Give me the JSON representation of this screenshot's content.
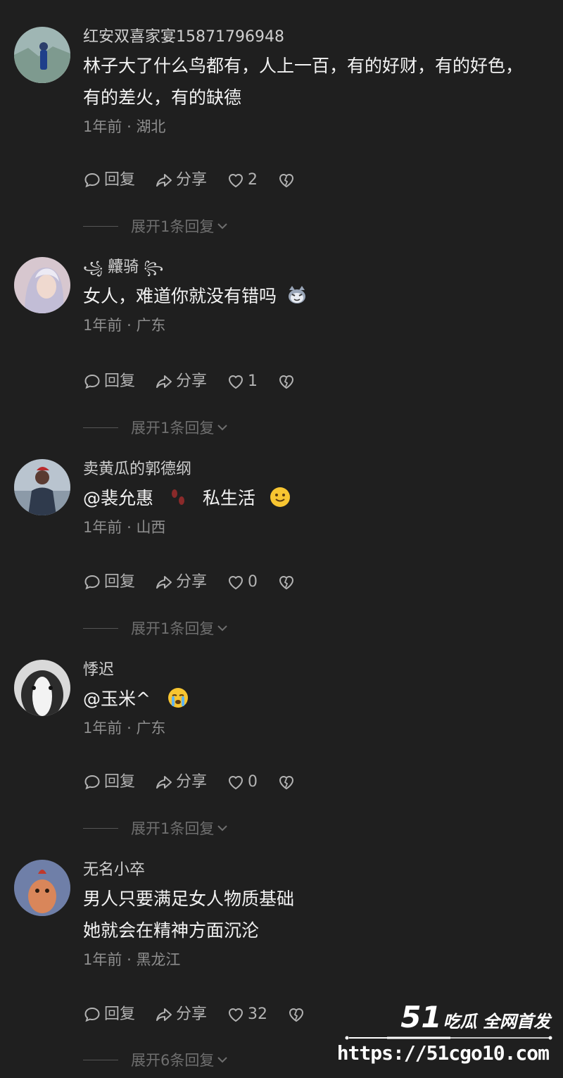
{
  "comments": [
    {
      "username": "红安双喜家宴15871796948",
      "text_lines": [
        "林子大了什么鸟都有，人上一百，有的好财，有的好色，",
        "有的差火，有的缺德"
      ],
      "time": "1年前",
      "location": "湖北",
      "reply_label": "回复",
      "share_label": "分享",
      "likes": "2",
      "expand_label": "展开1条回复"
    },
    {
      "username": "齉骑",
      "username_prefix": "꧁",
      "username_suffix": "꧂",
      "text": "女人，难道你就没有错吗",
      "emoji": "cat-face-emoji",
      "time": "1年前",
      "location": "广东",
      "reply_label": "回复",
      "share_label": "分享",
      "likes": "1",
      "expand_label": "展开1条回复"
    },
    {
      "username": "卖黄瓜的郭德纲",
      "mention": "@裴允惠",
      "text_after": "私生活",
      "emoji1": "footprints-emoji",
      "emoji2": "smiling-face-emoji",
      "time": "1年前",
      "location": "山西",
      "reply_label": "回复",
      "share_label": "分享",
      "likes": "0",
      "expand_label": "展开1条回复"
    },
    {
      "username": "悸迟",
      "mention": "@玉米^",
      "emoji": "crying-face-emoji",
      "time": "1年前",
      "location": "广东",
      "reply_label": "回复",
      "share_label": "分享",
      "likes": "0",
      "expand_label": "展开1条回复"
    },
    {
      "username": "无名小卒",
      "text_lines": [
        "男人只要满足女人物质基础",
        "她就会在精神方面沉沦"
      ],
      "time": "1年前",
      "location": "黑龙江",
      "reply_label": "回复",
      "share_label": "分享",
      "likes": "32",
      "expand_label": "展开6条回复"
    }
  ],
  "meta_separator": "·",
  "watermark": {
    "brand_number": "51",
    "brand_text": "吃瓜 全网首发",
    "url": "https://51cgo10.com"
  },
  "icons": {
    "reply": "comment-bubble-icon",
    "share": "share-arrow-icon",
    "like": "heart-icon",
    "dislike": "broken-heart-icon",
    "expand": "chevron-down-icon"
  }
}
